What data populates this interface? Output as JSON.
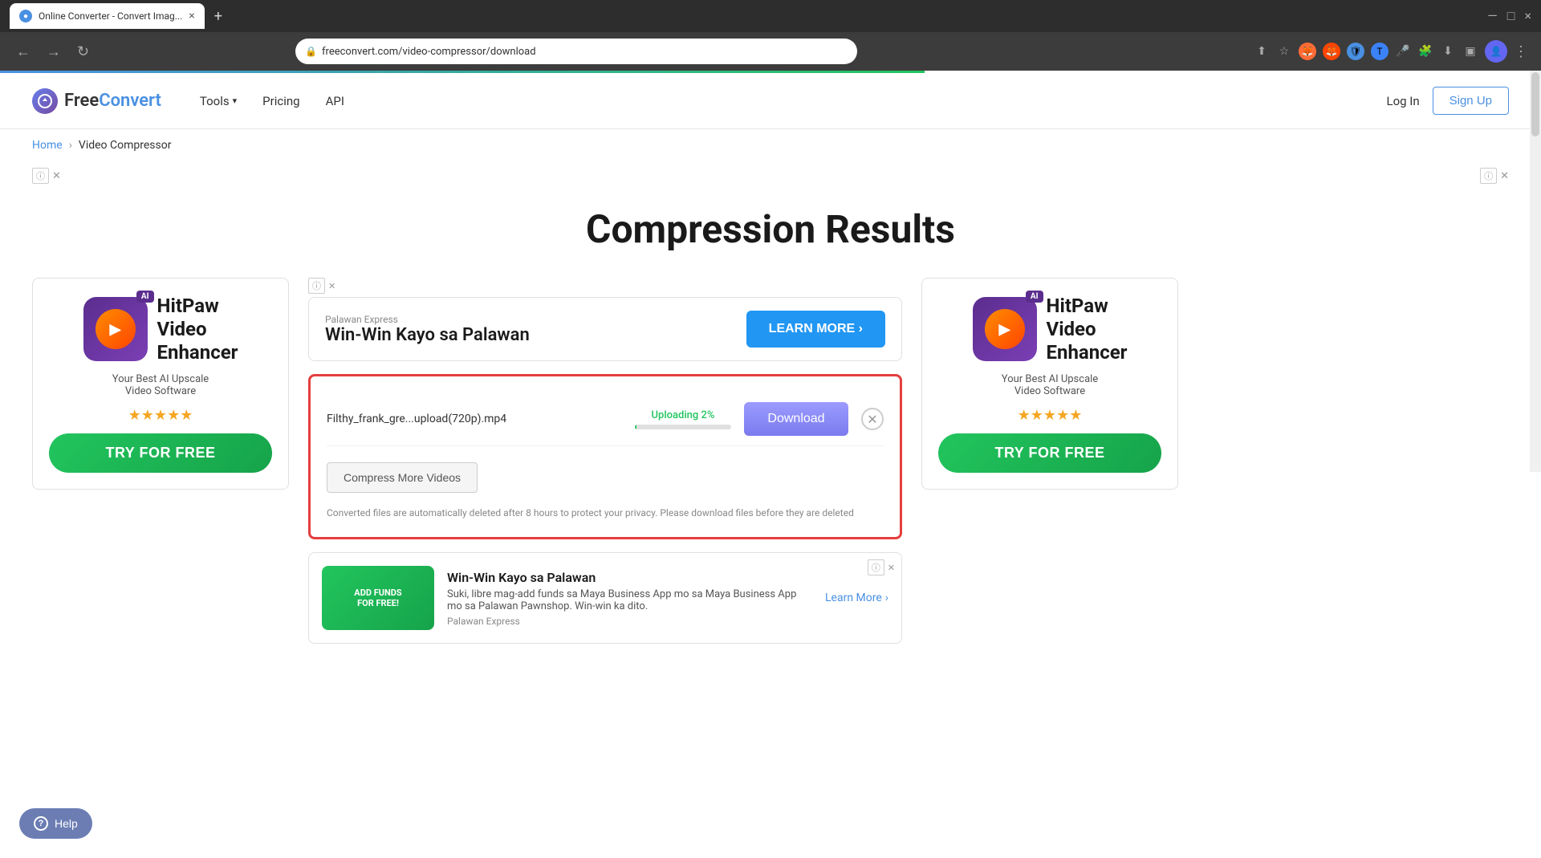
{
  "browser": {
    "tab_title": "Online Converter - Convert Imag...",
    "tab_close": "×",
    "new_tab": "+",
    "url": "freeconvert.com/video-compressor/download",
    "nav_back": "←",
    "nav_forward": "→",
    "nav_refresh": "↻",
    "three_dots": "⋮",
    "minimize": "—",
    "maximize": "□",
    "close": "×"
  },
  "navbar": {
    "logo_free": "Free",
    "logo_convert": "Convert",
    "tools_label": "Tools",
    "pricing_label": "Pricing",
    "api_label": "API",
    "login_label": "Log In",
    "signup_label": "Sign Up"
  },
  "breadcrumb": {
    "home": "Home",
    "separator": "›",
    "current": "Video Compressor"
  },
  "page": {
    "title": "Compression Results"
  },
  "ad_top_palawan": {
    "source": "Palawan Express",
    "title": "Win-Win Kayo sa Palawan",
    "learn_more": "LEARN MORE ›"
  },
  "ad_left": {
    "brand": "HitPaw\nVideo\nEnhancer",
    "ai_badge": "AI",
    "desc": "Your Best AI Upscale\nVideo Software",
    "stars": "★★★★★",
    "cta": "TRY FOR FREE"
  },
  "ad_right": {
    "brand": "HitPaw\nVideo\nEnhancer",
    "ai_badge": "AI",
    "desc": "Your Best AI Upscale\nVideo Software",
    "stars": "★★★★★",
    "cta": "TRY FOR FREE"
  },
  "results": {
    "file_name": "Filthy_frank_gre...upload(720p).mp4",
    "upload_percent": "Uploading 2%",
    "download_label": "Download",
    "compress_more": "Compress More Videos",
    "privacy_note": "Converted files are automatically deleted after 8 hours to protect your privacy. Please download files before they are deleted"
  },
  "ad_bottom": {
    "title": "Win-Win Kayo sa Palawan",
    "desc": "Suki, libre mag-add funds sa Maya Business App mo sa Maya Business App mo sa Palawan Pawnshop. Win-win ka dito.",
    "source": "Palawan Express",
    "learn_more": "Learn More",
    "img_text": "ADD FUNDS\nFOR FREE!"
  },
  "help": {
    "label": "Help"
  }
}
